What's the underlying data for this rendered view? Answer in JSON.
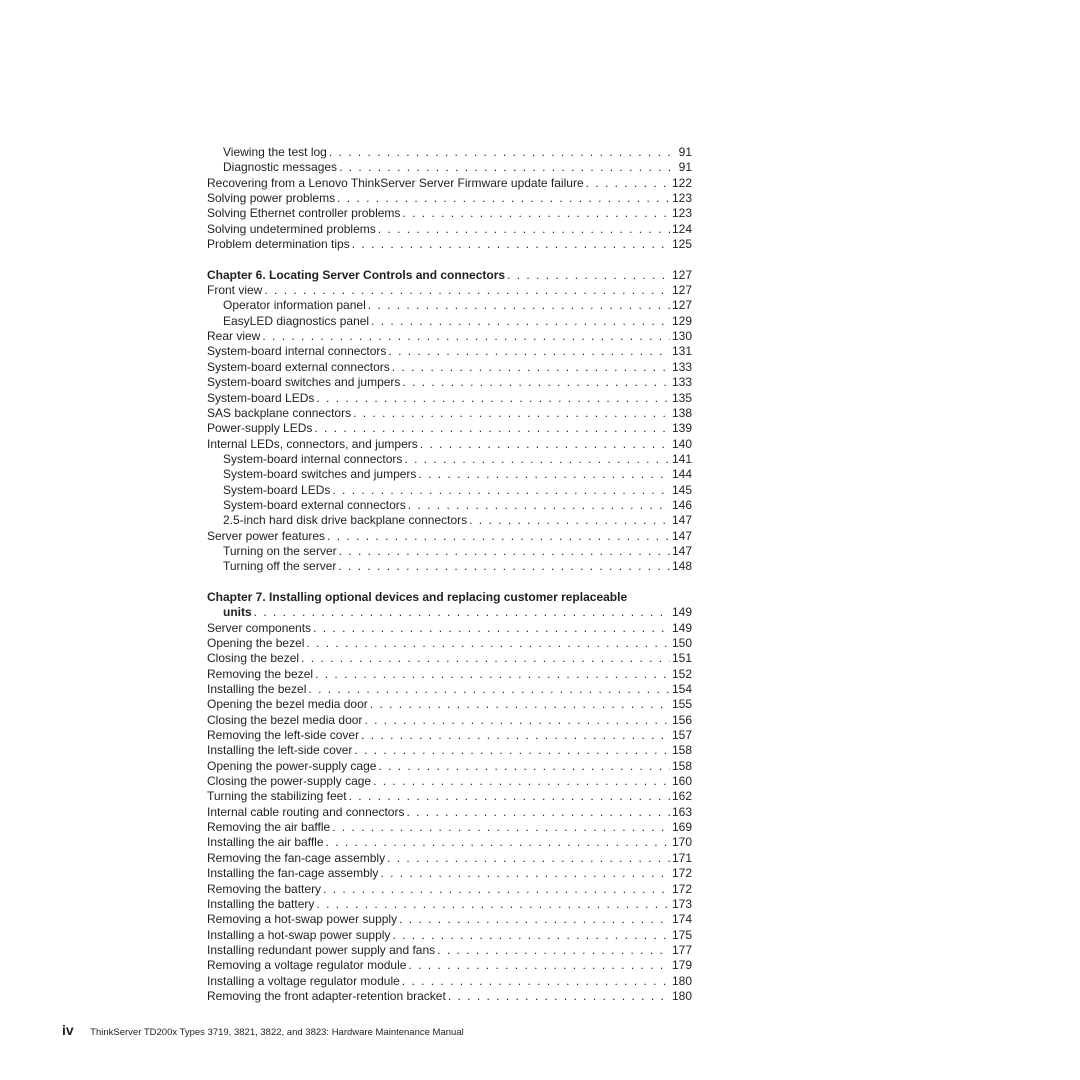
{
  "toc": {
    "group1": [
      {
        "title": "Viewing the test log",
        "page": "91",
        "level": 2
      },
      {
        "title": "Diagnostic messages",
        "page": "91",
        "level": 2
      },
      {
        "title": "Recovering from a Lenovo ThinkServer Server Firmware update failure",
        "page": "122",
        "level": 1
      },
      {
        "title": "Solving power problems",
        "page": "123",
        "level": 1
      },
      {
        "title": "Solving Ethernet controller problems",
        "page": "123",
        "level": 1
      },
      {
        "title": "Solving undetermined problems",
        "page": "124",
        "level": 1
      },
      {
        "title": "Problem determination tips",
        "page": "125",
        "level": 1
      }
    ],
    "chapter6": {
      "title": "Chapter 6. Locating Server Controls and connectors",
      "page": "127"
    },
    "group2": [
      {
        "title": "Front view",
        "page": "127",
        "level": 1
      },
      {
        "title": "Operator information panel",
        "page": "127",
        "level": 2
      },
      {
        "title": "EasyLED diagnostics panel",
        "page": "129",
        "level": 2
      },
      {
        "title": "Rear view",
        "page": "130",
        "level": 1
      },
      {
        "title": "System-board internal connectors",
        "page": "131",
        "level": 1
      },
      {
        "title": "System-board external connectors",
        "page": "133",
        "level": 1
      },
      {
        "title": "System-board switches and jumpers",
        "page": "133",
        "level": 1
      },
      {
        "title": "System-board LEDs",
        "page": "135",
        "level": 1
      },
      {
        "title": "SAS backplane connectors",
        "page": "138",
        "level": 1
      },
      {
        "title": "Power-supply LEDs",
        "page": "139",
        "level": 1
      },
      {
        "title": "Internal LEDs, connectors, and jumpers",
        "page": "140",
        "level": 1
      },
      {
        "title": "System-board internal connectors",
        "page": "141",
        "level": 2
      },
      {
        "title": "System-board switches and jumpers",
        "page": "144",
        "level": 2
      },
      {
        "title": "System-board LEDs",
        "page": "145",
        "level": 2
      },
      {
        "title": "System-board external connectors",
        "page": "146",
        "level": 2
      },
      {
        "title": "2.5-inch hard disk drive backplane connectors",
        "page": "147",
        "level": 2
      },
      {
        "title": "Server power features",
        "page": "147",
        "level": 1
      },
      {
        "title": "Turning on the server",
        "page": "147",
        "level": 2
      },
      {
        "title": "Turning off the server",
        "page": "148",
        "level": 2
      }
    ],
    "chapter7": {
      "title_line1": "Chapter 7. Installing optional devices and replacing customer replaceable",
      "title_line2": "units",
      "page": "149"
    },
    "group3": [
      {
        "title": "Server components",
        "page": "149",
        "level": 1
      },
      {
        "title": "Opening the bezel",
        "page": "150",
        "level": 1
      },
      {
        "title": "Closing the bezel",
        "page": "151",
        "level": 1
      },
      {
        "title": "Removing the bezel",
        "page": "152",
        "level": 1
      },
      {
        "title": "Installing the bezel",
        "page": "154",
        "level": 1
      },
      {
        "title": "Opening the bezel media door",
        "page": "155",
        "level": 1
      },
      {
        "title": "Closing the bezel media door",
        "page": "156",
        "level": 1
      },
      {
        "title": "Removing the left-side cover",
        "page": "157",
        "level": 1
      },
      {
        "title": "Installing the left-side cover",
        "page": "158",
        "level": 1
      },
      {
        "title": "Opening the power-supply cage",
        "page": "158",
        "level": 1
      },
      {
        "title": "Closing the power-supply cage",
        "page": "160",
        "level": 1
      },
      {
        "title": "Turning the stabilizing feet",
        "page": "162",
        "level": 1
      },
      {
        "title": "Internal cable routing and connectors",
        "page": "163",
        "level": 1
      },
      {
        "title": "Removing the air baffle",
        "page": "169",
        "level": 1
      },
      {
        "title": "Installing the air baffle",
        "page": "170",
        "level": 1
      },
      {
        "title": "Removing the fan-cage assembly",
        "page": "171",
        "level": 1
      },
      {
        "title": "Installing the fan-cage assembly",
        "page": "172",
        "level": 1
      },
      {
        "title": "Removing the battery",
        "page": "172",
        "level": 1
      },
      {
        "title": "Installing the battery",
        "page": "173",
        "level": 1
      },
      {
        "title": "Removing a hot-swap power supply",
        "page": "174",
        "level": 1
      },
      {
        "title": "Installing a hot-swap power supply",
        "page": "175",
        "level": 1
      },
      {
        "title": "Installing redundant power supply and fans",
        "page": "177",
        "level": 1
      },
      {
        "title": "Removing a voltage regulator module",
        "page": "179",
        "level": 1
      },
      {
        "title": "Installing a voltage regulator module",
        "page": "180",
        "level": 1
      },
      {
        "title": "Removing the front adapter-retention bracket",
        "page": "180",
        "level": 1
      }
    ]
  },
  "footer": {
    "page_number": "iv",
    "manual_title": "ThinkServer TD200x Types 3719, 3821, 3822, and 3823:  Hardware Maintenance Manual"
  }
}
